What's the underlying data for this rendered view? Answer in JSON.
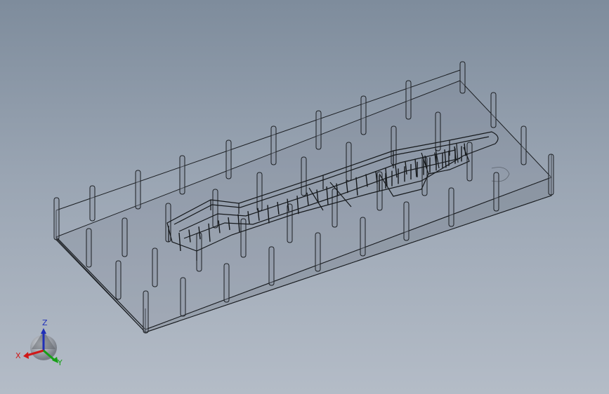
{
  "view": {
    "background_top": "#7e8c9c",
    "background_bottom": "#b4bcc7",
    "edge_color": "#1b1e22",
    "face_color": "#6a7480"
  },
  "triad": {
    "z_label": "Z",
    "x_label": "X",
    "y_label": "Y",
    "z_color": "#1f2fb8",
    "x_color": "#d01818",
    "y_color": "#16a016"
  }
}
